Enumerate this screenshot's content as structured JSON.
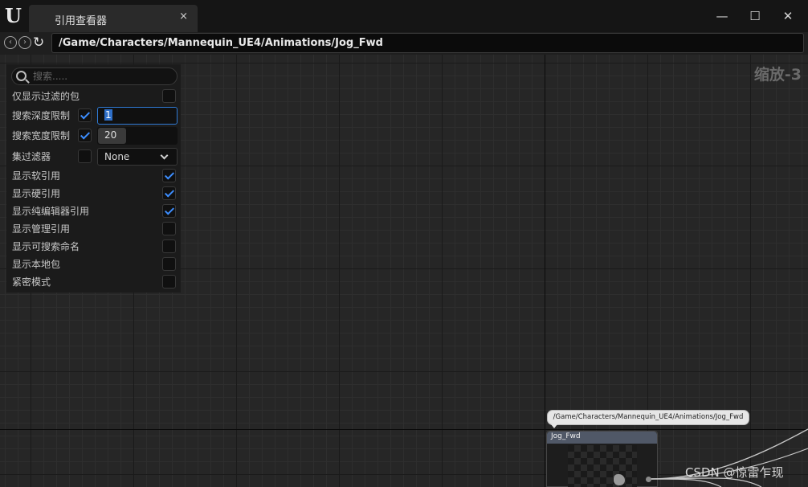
{
  "window": {
    "tab_title": "引用查看器",
    "tab_close": "×",
    "minimize": "—",
    "maximize": "☐",
    "close": "✕"
  },
  "nav": {
    "path": "/Game/Characters/Mannequin_UE4/Animations/Jog_Fwd"
  },
  "canvas": {
    "zoom_label": "缩放-3"
  },
  "panel": {
    "search_placeholder": "搜索.....",
    "only_filtered": {
      "label": "仅显示过滤的包",
      "checked": false
    },
    "depth_limit": {
      "label": "搜索深度限制",
      "checked": true,
      "value": "1"
    },
    "breadth_limit": {
      "label": "搜索宽度限制",
      "checked": true,
      "value": "20"
    },
    "collection_filter": {
      "label": "集过滤器",
      "checked": false,
      "value": "None"
    },
    "options": [
      {
        "label": "显示软引用",
        "checked": true
      },
      {
        "label": "显示硬引用",
        "checked": true
      },
      {
        "label": "显示纯编辑器引用",
        "checked": true
      },
      {
        "label": "显示管理引用",
        "checked": false
      },
      {
        "label": "显示可搜索命名",
        "checked": false
      },
      {
        "label": "显示本地包",
        "checked": false
      },
      {
        "label": "紧密模式",
        "checked": false
      }
    ]
  },
  "node": {
    "tooltip": "/Game/Characters/Mannequin_UE4/Animations/Jog_Fwd",
    "title": "Jog_Fwd"
  },
  "watermark": "CSDN @惊雷乍现",
  "icons": [
    "unreal-logo-icon",
    "back-icon",
    "forward-icon",
    "refresh-icon",
    "search-icon",
    "checkmark-icon",
    "chevron-down-icon"
  ],
  "colors": {
    "accent": "#3d8eff",
    "focus": "#2f7bd6",
    "background": "#262626"
  }
}
